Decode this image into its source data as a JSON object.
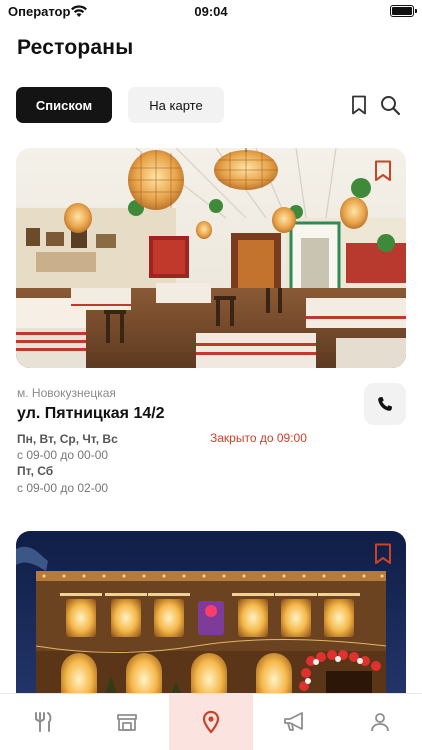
{
  "status": {
    "carrier": "Оператор",
    "time": "09:04"
  },
  "header": {
    "title": "Рестораны"
  },
  "view_toggle": {
    "list_label": "Списком",
    "map_label": "На карте"
  },
  "restaurants": [
    {
      "metro": "м. Новокузнецкая",
      "address": "ул. Пятницкая 14/2",
      "status": "Закрыто до 09:00",
      "schedule": [
        {
          "days": "Пн, Вт, Ср, Чт, Вс",
          "hours": "с 09-00 до 00-00"
        },
        {
          "days": "Пт, Сб",
          "hours": "с 09-00 до 02-00"
        }
      ]
    },
    {}
  ],
  "tabs": [
    {
      "name": "menu",
      "icon": "fork-knife-icon"
    },
    {
      "name": "restaurants-store",
      "icon": "store-icon"
    },
    {
      "name": "locations",
      "icon": "map-pin-icon",
      "active": true
    },
    {
      "name": "promo",
      "icon": "megaphone-icon"
    },
    {
      "name": "profile",
      "icon": "user-icon"
    }
  ],
  "colors": {
    "accent": "#c8432a",
    "active_tab_bg": "#fbe3df",
    "closed_text": "#d0402a",
    "primary_button": "#141414"
  }
}
